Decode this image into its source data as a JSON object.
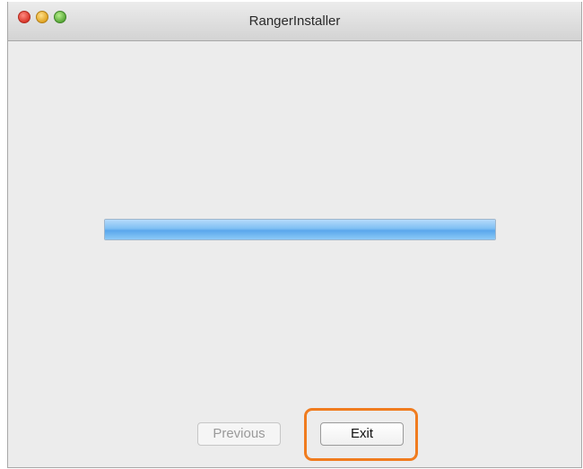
{
  "window": {
    "title": "RangerInstaller"
  },
  "progress": {
    "fraction": 1.0
  },
  "buttons": {
    "previous_label": "Previous",
    "previous_enabled": false,
    "exit_label": "Exit"
  },
  "annotation": {
    "highlight_color": "#f07c1f",
    "highlight_target": "exit-button"
  },
  "icons": {
    "close": "close-icon",
    "minimize": "minimize-icon",
    "zoom": "zoom-icon"
  }
}
